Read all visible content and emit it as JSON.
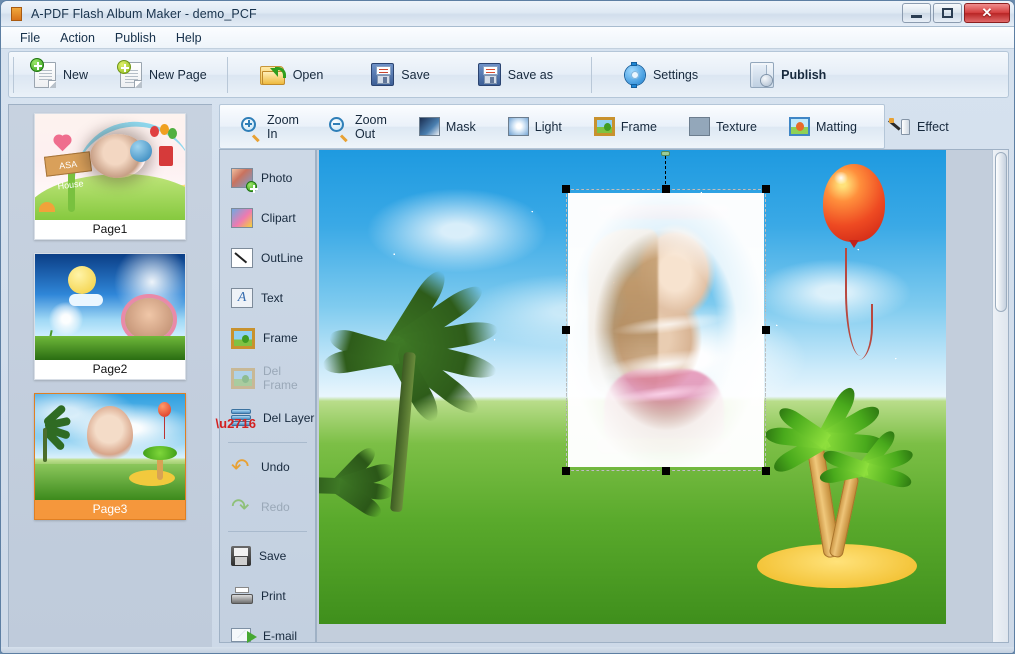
{
  "window": {
    "title": "A-PDF Flash Album Maker - demo_PCF",
    "app_icon": "album-icon",
    "minimize_label": "Minimize",
    "maximize_label": "Maximize",
    "close_label": "✕"
  },
  "menu": {
    "items": [
      {
        "label": "File",
        "name": "menu-file"
      },
      {
        "label": "Action",
        "name": "menu-action"
      },
      {
        "label": "Publish",
        "name": "menu-publish"
      },
      {
        "label": "Help",
        "name": "menu-help"
      }
    ]
  },
  "main_toolbar": {
    "buttons": [
      {
        "label": "New",
        "icon": "new-document-icon",
        "group": 1
      },
      {
        "label": "New Page",
        "icon": "new-page-icon",
        "group": 1
      },
      {
        "label": "Open",
        "icon": "open-folder-icon",
        "group": 2
      },
      {
        "label": "Save",
        "icon": "floppy-save-icon",
        "group": 2
      },
      {
        "label": "Save as",
        "icon": "floppy-save-as-icon",
        "group": 2
      },
      {
        "label": "Settings",
        "icon": "gear-icon",
        "group": 3
      },
      {
        "label": "Publish",
        "icon": "publish-book-icon",
        "group": 3,
        "bold": true
      }
    ]
  },
  "sub_toolbar": {
    "buttons": [
      {
        "label": "Zoom In",
        "icon": "zoom-in-icon"
      },
      {
        "label": "Zoom Out",
        "icon": "zoom-out-icon"
      },
      {
        "label": "Mask",
        "icon": "mask-icon"
      },
      {
        "label": "Light",
        "icon": "light-icon"
      },
      {
        "label": "Frame",
        "icon": "frame-icon"
      },
      {
        "label": "Texture",
        "icon": "texture-icon"
      },
      {
        "label": "Matting",
        "icon": "matting-icon"
      },
      {
        "label": "Effect",
        "icon": "effect-brush-icon"
      }
    ]
  },
  "tool_column": {
    "items": [
      {
        "label": "Photo",
        "icon": "photo-add-icon",
        "enabled": true
      },
      {
        "label": "Clipart",
        "icon": "clipart-icon",
        "enabled": true
      },
      {
        "label": "OutLine",
        "icon": "outline-icon",
        "enabled": true
      },
      {
        "label": "Text",
        "icon": "text-icon",
        "enabled": true
      },
      {
        "label": "Frame",
        "icon": "frame-icon",
        "enabled": true
      },
      {
        "label": "Del Frame",
        "icon": "delete-frame-icon",
        "enabled": false
      },
      {
        "label": "Del Layer",
        "icon": "delete-layer-icon",
        "enabled": true
      },
      {
        "label": "Undo",
        "icon": "undo-icon",
        "enabled": true
      },
      {
        "label": "Redo",
        "icon": "redo-icon",
        "enabled": false
      },
      {
        "label": "Save",
        "icon": "floppy-save-icon",
        "enabled": true
      },
      {
        "label": "Print",
        "icon": "printer-icon",
        "enabled": true
      },
      {
        "label": "E-mail",
        "icon": "email-icon",
        "enabled": true
      }
    ]
  },
  "pages_panel": {
    "pages": [
      {
        "label": "Page1",
        "selected": false,
        "thumbnail": "fairytale-hill-with-rainbow-and-girl-photo"
      },
      {
        "label": "Page2",
        "selected": false,
        "thumbnail": "dandelion-sky-with-moon-and-heart-photo"
      },
      {
        "label": "Page3",
        "selected": true,
        "thumbnail": "palm-beach-sky-with-balloon-and-girl-photo"
      }
    ]
  },
  "canvas": {
    "scene_name": "palm-beach-sky-with-balloon-and-girl-photo",
    "selected_object": "photo-frame-layer",
    "selection_handles": 8,
    "rotation_handle": true
  },
  "colors": {
    "selection_highlight": "#f5973c",
    "title_text": "#19334d",
    "close_button": "#c4332f",
    "sky_blue": "#3aa9e6",
    "grass_green": "#5aaa2c",
    "balloon_red": "#ee4a22"
  }
}
